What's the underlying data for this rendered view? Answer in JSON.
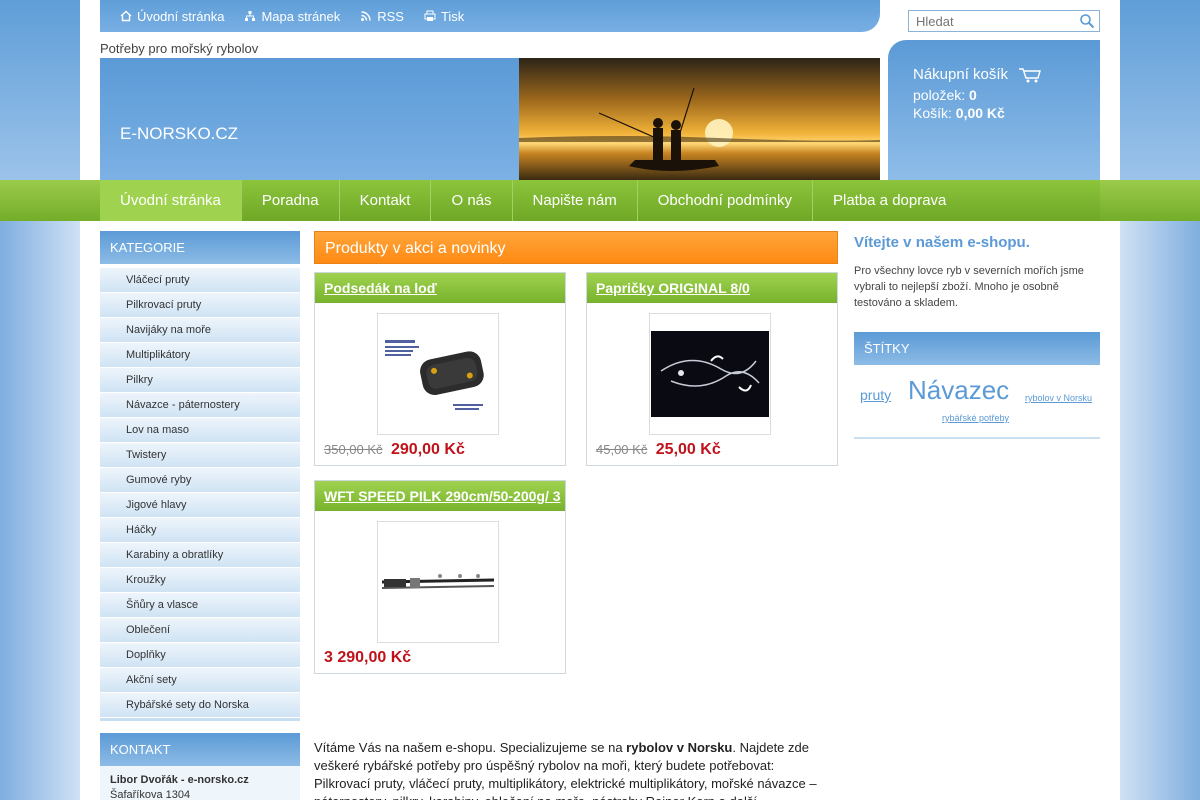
{
  "topnav": {
    "home": "Úvodní stránka",
    "sitemap": "Mapa stránek",
    "rss": "RSS",
    "print": "Tisk"
  },
  "search": {
    "placeholder": "Hledat"
  },
  "tagline": "Potřeby pro mořský rybolov",
  "site_name": "E-NORSKO.CZ",
  "cart": {
    "title": "Nákupní košík",
    "items_label": "položek:",
    "items_value": "0",
    "total_label": "Košík:",
    "total_value": "0,00 Kč"
  },
  "nav": [
    "Úvodní stránka",
    "Poradna",
    "Kontakt",
    "O nás",
    "Napište nám",
    "Obchodní podmínky",
    "Platba a doprava"
  ],
  "sidebar": {
    "heading": "KATEGORIE",
    "categories": [
      "Vláčecí pruty",
      "Pilkrovací pruty",
      "Navijáky na moře",
      "Multiplikátory",
      "Pilkry",
      "Návazce - páternostery",
      "Lov na maso",
      "Twistery",
      "Gumové ryby",
      "Jigové hlavy",
      "Háčky",
      "Karabiny a obratlíky",
      "Kroužky",
      "Šňůry a vlasce",
      "Oblečení",
      "Doplňky",
      "Akční sety",
      "Rybářské sety do Norska"
    ]
  },
  "contact": {
    "heading": "KONTAKT",
    "name": "Libor Dvořák - e-norsko.cz",
    "street": "Šafaříkova 1304"
  },
  "main": {
    "heading": "Produkty v akci a novinky",
    "products": [
      {
        "title": "Podsedák na loď",
        "old_price": "350,00 Kč",
        "price": "290,00 Kč"
      },
      {
        "title": "Papričky ORIGINAL 8/0",
        "old_price": "45,00 Kč",
        "price": "25,00 Kč"
      },
      {
        "title": "WFT SPEED PILK 290cm/50-200g/ 3",
        "old_price": "",
        "price": "3 290,00 Kč"
      }
    ],
    "intro_a": "Vítáme Vás na našem e-shopu. Specializujeme se na ",
    "intro_b": "rybolov v Norsku",
    "intro_c": ".  Najdete zde veškeré rybářské potřeby pro úspěšný rybolov na moři, který budete potřebovat: Pilkrovací pruty, vláčecí pruty, multiplikátory, elektrické multiplikátory, mořské návazce – páternostery, pilkry, karabiny, oblečení na moře, nástrahy Reiner Korn a další."
  },
  "welcome": {
    "title": "Vítejte v našem e-shopu.",
    "text": "Pro všechny lovce ryb v severních mořích jsme vybrali to nejlepší zboží. Mnoho je osobně testováno a skladem."
  },
  "tags": {
    "heading": "ŠTÍTKY",
    "items": [
      "pruty",
      "Návazec",
      "rybolov v Norsku",
      "rybářské potřeby"
    ]
  },
  "colors": {
    "blue": "#5b9ad6",
    "green": "#8cc43c",
    "orange": "#ff8a14",
    "price_red": "#c0121a"
  }
}
